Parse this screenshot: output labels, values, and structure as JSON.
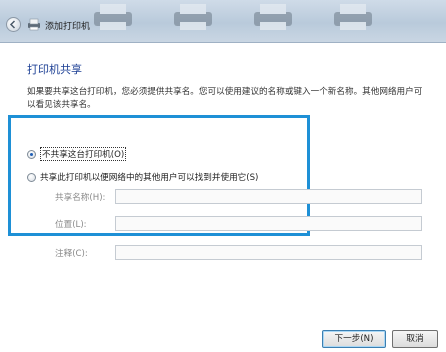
{
  "window": {
    "title": "添加打印机"
  },
  "page": {
    "heading": "打印机共享",
    "description": "如果要共享这台打印机，您必须提供共享名。您可以使用建议的名称或键入一个新名称。其他网络用户可以看见该共享名。"
  },
  "options": {
    "no_share": {
      "label": "不共享这台打印机(O)",
      "selected": true
    },
    "share": {
      "label": "共享此打印机以便网络中的其他用户可以找到并使用它(S)",
      "selected": false
    }
  },
  "fields": {
    "share_name": {
      "label": "共享名称(H):",
      "value": ""
    },
    "location": {
      "label": "位置(L):",
      "value": ""
    },
    "comment": {
      "label": "注释(C):",
      "value": ""
    }
  },
  "buttons": {
    "next": "下一步(N)",
    "cancel": "取消"
  },
  "colors": {
    "highlight": "#1e90d6",
    "heading": "#1c3f94"
  }
}
